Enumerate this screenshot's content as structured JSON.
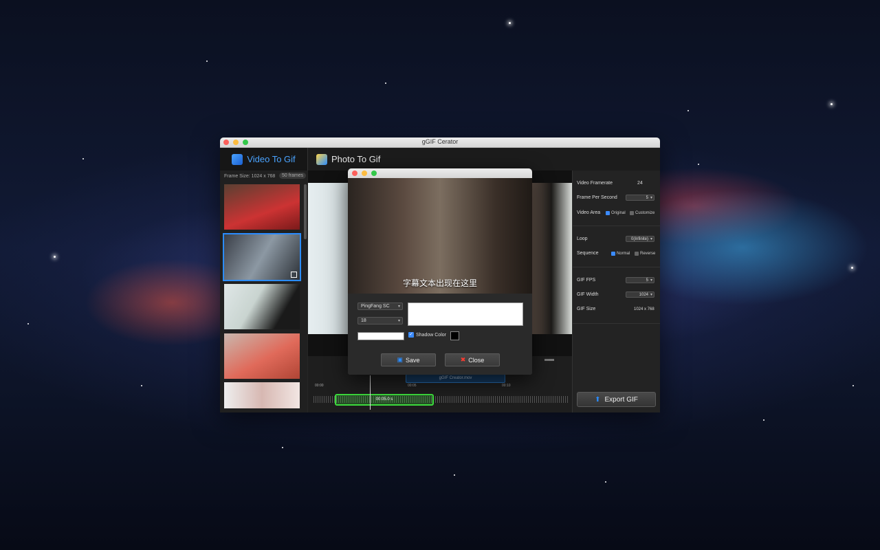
{
  "window": {
    "title": "gGIF Cerator"
  },
  "tabs": [
    {
      "label": "Video To Gif",
      "active": true
    },
    {
      "label": "Photo To Gif",
      "active": false
    }
  ],
  "left_pane": {
    "frame_size": "Frame Size: 1024 x 768",
    "frames_badge": "50 frames"
  },
  "timeline": {
    "ticks": [
      "00:00",
      "00:05",
      "00:10"
    ],
    "clip_name": "gGIF Creator.mov",
    "selection_label": "00:05.0 s"
  },
  "settings": {
    "video_framerate_label": "Video Framerate",
    "video_framerate_value": "24",
    "fps_label": "Frame Per Second",
    "fps_value": "5",
    "video_area_label": "Video Area",
    "video_area_original": "Original",
    "video_area_customize": "Customize",
    "loop_label": "Loop",
    "loop_value": "0(Infinite)",
    "sequence_label": "Sequence",
    "sequence_normal": "Normal",
    "sequence_reverse": "Reverse",
    "gif_fps_label": "GIF FPS",
    "gif_fps_value": "5",
    "gif_width_label": "GIF Width",
    "gif_width_value": "1024",
    "gif_size_label": "GIF Size",
    "gif_size_value": "1024 x 768",
    "export_label": "Export GIF"
  },
  "dialog": {
    "caption": "字幕文本出现在这里",
    "font_value": "PingFang SC",
    "size_value": "18",
    "shadow_label": "Shadow Color",
    "save_label": "Save",
    "close_label": "Close"
  },
  "colors": {
    "accent": "#2a8cff",
    "window_bg": "#262626",
    "selection_green": "#3ddc3d"
  }
}
